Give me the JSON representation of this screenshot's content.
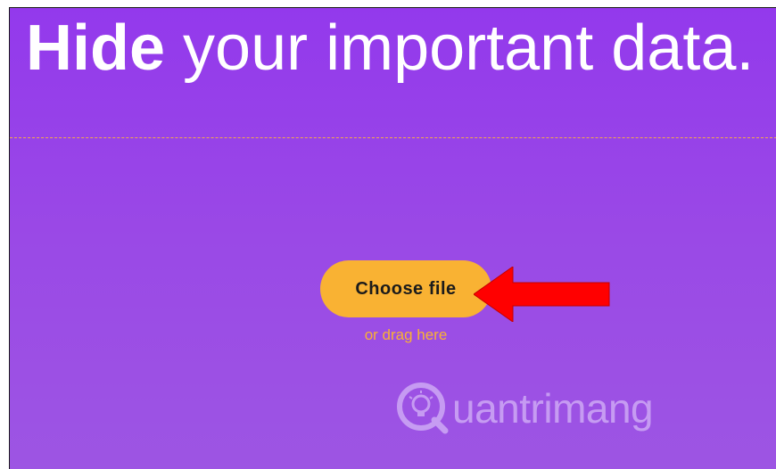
{
  "header": {
    "headline_bold": "Hide",
    "headline_rest": " your important data."
  },
  "upload": {
    "button_label": "Choose file",
    "hint_text": "or drag here"
  },
  "watermark": {
    "text": "uantrimang",
    "logo_icon": "lightbulb-q-icon"
  },
  "annotation": {
    "arrow_icon": "red-arrow-left-icon",
    "arrow_color": "#ff0000"
  },
  "colors": {
    "background": "#9339ec",
    "accent": "#f9b233",
    "dashed_rule": "#f2a94b"
  }
}
